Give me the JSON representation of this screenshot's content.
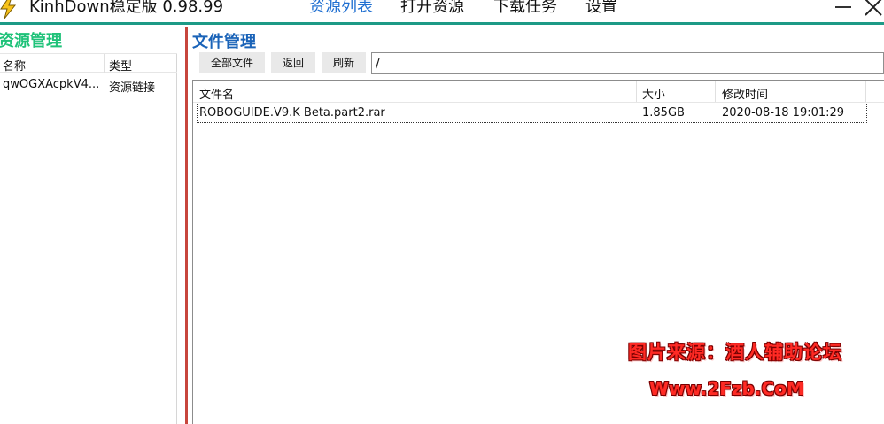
{
  "window": {
    "title": "KinhDown稳定版 0.98.99",
    "icon": "lightning-bolt-icon"
  },
  "nav": {
    "items": [
      {
        "label": "资源列表",
        "active": true
      },
      {
        "label": "打开资源",
        "active": false
      },
      {
        "label": "下载任务",
        "active": false
      },
      {
        "label": "设置",
        "active": false
      }
    ]
  },
  "controls": {
    "minimize_icon": "minimize-icon",
    "close_icon": "close-icon"
  },
  "left_panel": {
    "title": "资源管理",
    "columns": [
      "名称",
      "类型"
    ],
    "rows": [
      {
        "name": "qwOGXAcpkV4...",
        "type": "资源链接"
      }
    ]
  },
  "right_panel": {
    "title": "文件管理",
    "buttons": {
      "all_files": "全部文件",
      "back": "返回",
      "refresh": "刷新"
    },
    "path": "/",
    "columns": [
      "文件名",
      "大小",
      "修改时间"
    ],
    "files": [
      {
        "name": "ROBOGUIDE.V9.K Beta.part2.rar",
        "size": "1.85GB",
        "modified": "2020-08-18 19:01:29"
      }
    ]
  },
  "watermark": {
    "line1": "图片来源：酒人辅助论坛",
    "line2": "Www.2Fzb.CoM"
  },
  "colors": {
    "accent_nav": "#1f6fd1",
    "left_title": "#1fc279",
    "right_title": "#1a63b8",
    "titlebar_rule": "#1d9a86",
    "splitter": "#c7463d",
    "watermark": "#ff2a24"
  }
}
